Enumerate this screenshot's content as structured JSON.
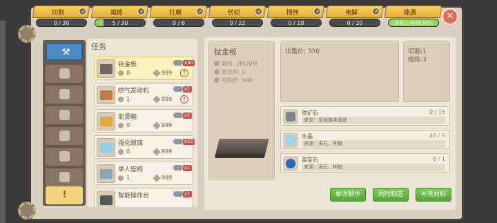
{
  "top_tabs": [
    {
      "name": "切割",
      "value": "0 / 30",
      "progress": 0,
      "active": false
    },
    {
      "name": "熔炼",
      "value": "5 / 30",
      "progress": 0.167,
      "active": false
    },
    {
      "name": "打磨",
      "value": "0 / 6",
      "progress": 0,
      "active": false
    },
    {
      "name": "纺织",
      "value": "0 / 22",
      "progress": 0,
      "active": false
    },
    {
      "name": "搅拌",
      "value": "0 / 18",
      "progress": 0,
      "active": false
    },
    {
      "name": "电解",
      "value": "0 / 20",
      "progress": 0,
      "active": false
    },
    {
      "name": "能源",
      "value": "消耗1/持续36%",
      "progress": 1.0,
      "active": false
    }
  ],
  "task_panel": {
    "title": "任务",
    "items": [
      {
        "name": "钛金板",
        "qty": "0",
        "cost": "999",
        "badge": "x30",
        "warn": "!",
        "selected": true,
        "color": "#6e6763"
      },
      {
        "name": "喷气发动机",
        "qty": "1",
        "cost": "999",
        "badge": "x1",
        "warn": "!",
        "selected": false,
        "color": "#c47b4a"
      },
      {
        "name": "能源箱",
        "qty": "0",
        "cost": "999",
        "badge": "x1",
        "warn": "",
        "selected": false,
        "color": "#e0a93d"
      },
      {
        "name": "强化玻璃",
        "qty": "0",
        "cost": "999",
        "badge": "x10",
        "warn": "",
        "selected": false,
        "color": "#8fd0e8"
      },
      {
        "name": "单人座椅",
        "qty": "1",
        "cost": "999",
        "badge": "x1",
        "warn": "",
        "selected": false,
        "color": "#8aa6bd"
      },
      {
        "name": "智能操作台",
        "qty": "",
        "cost": "",
        "badge": "x1",
        "warn": "",
        "selected": false,
        "color": "#585858"
      }
    ]
  },
  "detail": {
    "name": "钛金板",
    "time": "耗时: 2时20分",
    "bag": "背包内: 0",
    "craftable": "可制作: 999",
    "sale": "出售价: 350",
    "skills": [
      "切割:1",
      "熔炼:3"
    ],
    "materials": [
      {
        "name": "钛矿石",
        "have": "0",
        "need": "/ 15",
        "source": "来源：湿地废弃遗迹",
        "color": "#7d8590"
      },
      {
        "name": "水晶",
        "have": "40",
        "need": "/ 6",
        "source": "来源：采石、种植",
        "color": "#9ad4ec"
      },
      {
        "name": "蓝宝石",
        "have": "0",
        "need": "/ 1",
        "source": "来源：采石、种植",
        "color": "#2f63c4"
      }
    ]
  },
  "buttons": {
    "single": "单次制作",
    "batch": "同时制造",
    "refill": "补充材料"
  },
  "close_icon": "✕"
}
